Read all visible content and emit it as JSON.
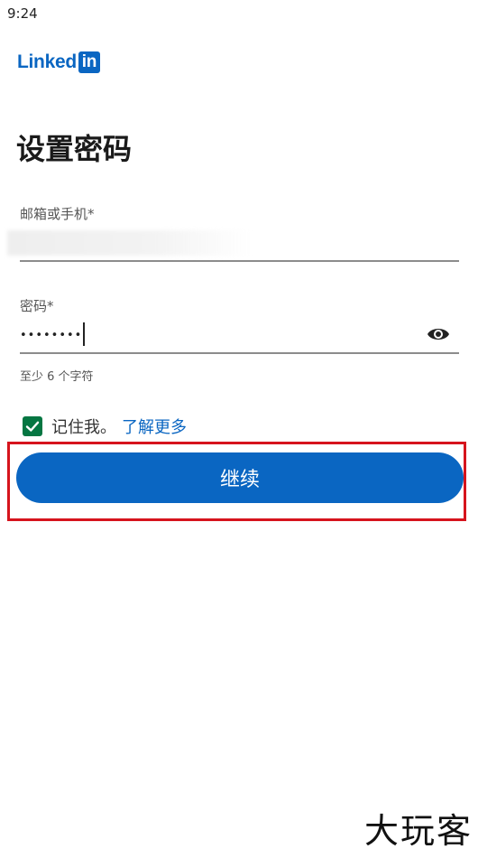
{
  "status_bar": {
    "time": "9:24"
  },
  "brand": {
    "name_text": "Linked",
    "box_text": "in",
    "color": "#0a66c2"
  },
  "page": {
    "title": "设置密码"
  },
  "email": {
    "label": "邮箱或手机*",
    "value": ""
  },
  "password": {
    "label": "密码*",
    "value": "••••••••••",
    "hint": "至少 6 个字符",
    "toggle_icon": "eye-icon"
  },
  "remember": {
    "checked": true,
    "label": "记住我。",
    "link": "了解更多",
    "checkbox_color": "#057642"
  },
  "actions": {
    "continue_label": "继续",
    "button_color": "#0a66c2"
  },
  "watermark": {
    "text": "大玩客"
  }
}
